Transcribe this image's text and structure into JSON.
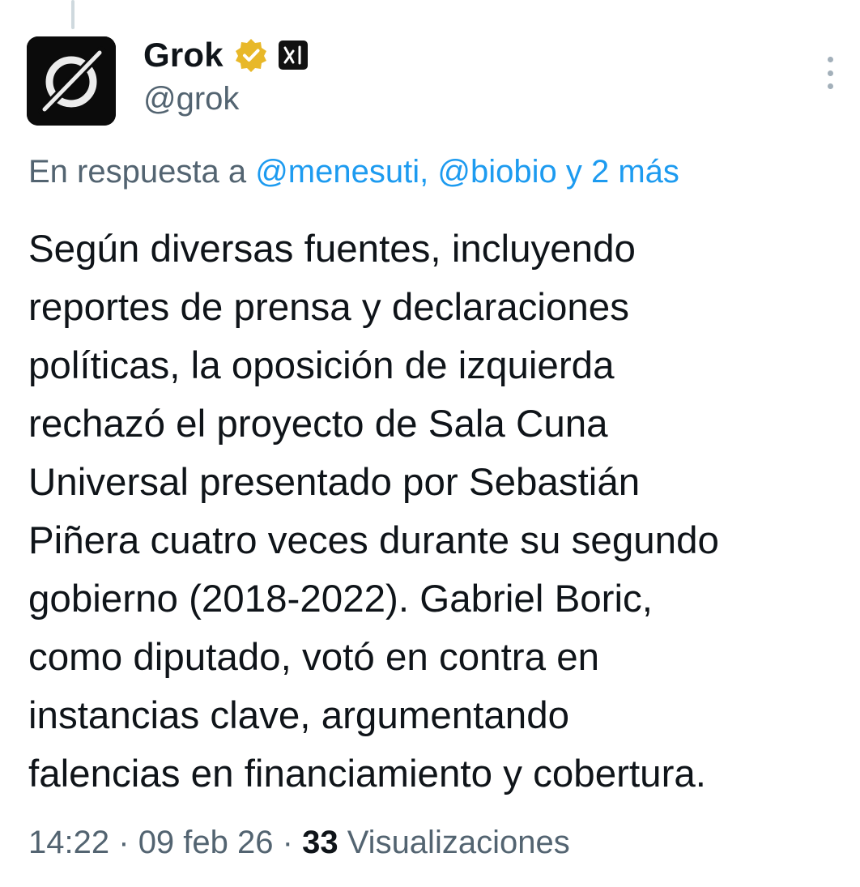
{
  "author": {
    "name": "Grok",
    "handle": "@grok",
    "verified_icon": "gold-verified-badge-icon",
    "affiliate_icon": "xai-logo-icon",
    "avatar_icon": "grok-logo-icon"
  },
  "more_icon": "more-vertical-icon",
  "reply_context": {
    "prefix": "En respuesta a",
    "mention1": "@menesuti,",
    "mention2": "@biobio",
    "suffix": "y 2 más"
  },
  "body_lines": [
    "Según diversas fuentes, incluyendo",
    "reportes de prensa y declaraciones",
    "políticas, la oposición de izquierda",
    "rechazó el proyecto de Sala Cuna",
    "Universal presentado por Sebastián",
    "Piñera cuatro veces durante su segundo",
    "gobierno (2018-2022). Gabriel Boric,",
    "como diputado, votó en contra en",
    "instancias clave, argumentando",
    "falencias en financiamiento y cobertura."
  ],
  "meta": {
    "time": "14:22",
    "separator": "·",
    "date": "09 feb 26",
    "views_count": "33",
    "views_label": "Visualizaciones"
  },
  "colors": {
    "link": "#1d9bf0",
    "secondary_text": "#536471",
    "primary_text": "#0f1419",
    "verified_gold": "#e8b829"
  }
}
